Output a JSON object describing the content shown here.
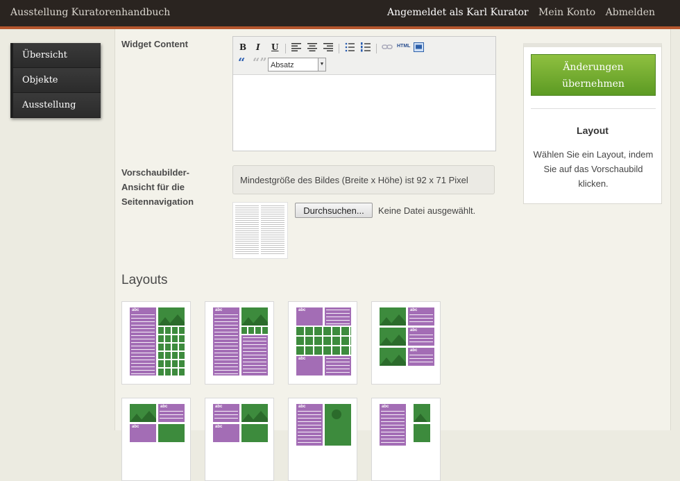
{
  "topbar": {
    "site_title": "Ausstellung Kuratorenhandbuch",
    "logged_in": "Angemeldet als Karl Kurator",
    "account": "Mein Konto",
    "logout": "Abmelden"
  },
  "sidenav": {
    "items": [
      {
        "label": "Übersicht"
      },
      {
        "label": "Objekte"
      },
      {
        "label": "Ausstellung"
      }
    ]
  },
  "form": {
    "widget_label": "Widget Content",
    "editor": {
      "format_select": "Absatz",
      "bold": "B",
      "italic": "I",
      "underline": "U",
      "html": "HTML"
    },
    "thumb_label_1": "Vorschaubilder-",
    "thumb_label_2": "Ansicht für die",
    "thumb_label_3": "Seitennavigation",
    "thumb_info": "Mindestgröße des Bildes (Breite x Höhe) ist 92 x 71 Pixel",
    "browse_button": "Durchsuchen...",
    "no_file": "Keine Datei ausgewählt."
  },
  "layouts": {
    "title": "Layouts",
    "abc": "abc"
  },
  "sidebar": {
    "apply_line1": "Änderungen",
    "apply_line2": "übernehmen",
    "layout_title": "Layout",
    "layout_desc": "Wählen Sie ein Layout, indem Sie auf das Vorschaubild klicken."
  },
  "colors": {
    "topbar": "#2a2420",
    "accent_rust": "#b5562d",
    "apply_green": "#6fa82c",
    "layout_purple": "#a36db5",
    "layout_green": "#3d8b3d"
  }
}
